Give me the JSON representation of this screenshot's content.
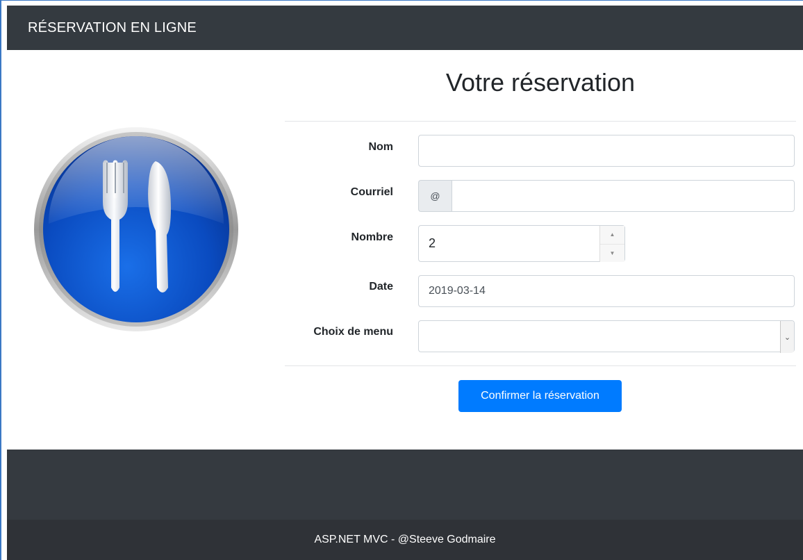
{
  "navbar": {
    "brand": "RÉSERVATION EN LIGNE"
  },
  "logo": {
    "icon": "fork-knife-icon"
  },
  "form": {
    "title": "Votre réservation",
    "fields": {
      "nom": {
        "label": "Nom",
        "value": ""
      },
      "courriel": {
        "label": "Courriel",
        "addon": "@",
        "value": ""
      },
      "nombre": {
        "label": "Nombre",
        "value": "2"
      },
      "date": {
        "label": "Date",
        "value": "2019-03-14"
      },
      "menu": {
        "label": "Choix de menu",
        "value": ""
      }
    },
    "submit_label": "Confirmer la réservation"
  },
  "footer": {
    "text": "ASP.NET MVC - @Steeve Godmaire"
  },
  "colors": {
    "navbar": "#343a40",
    "primary": "#007bff",
    "footer": "#2f3237"
  }
}
